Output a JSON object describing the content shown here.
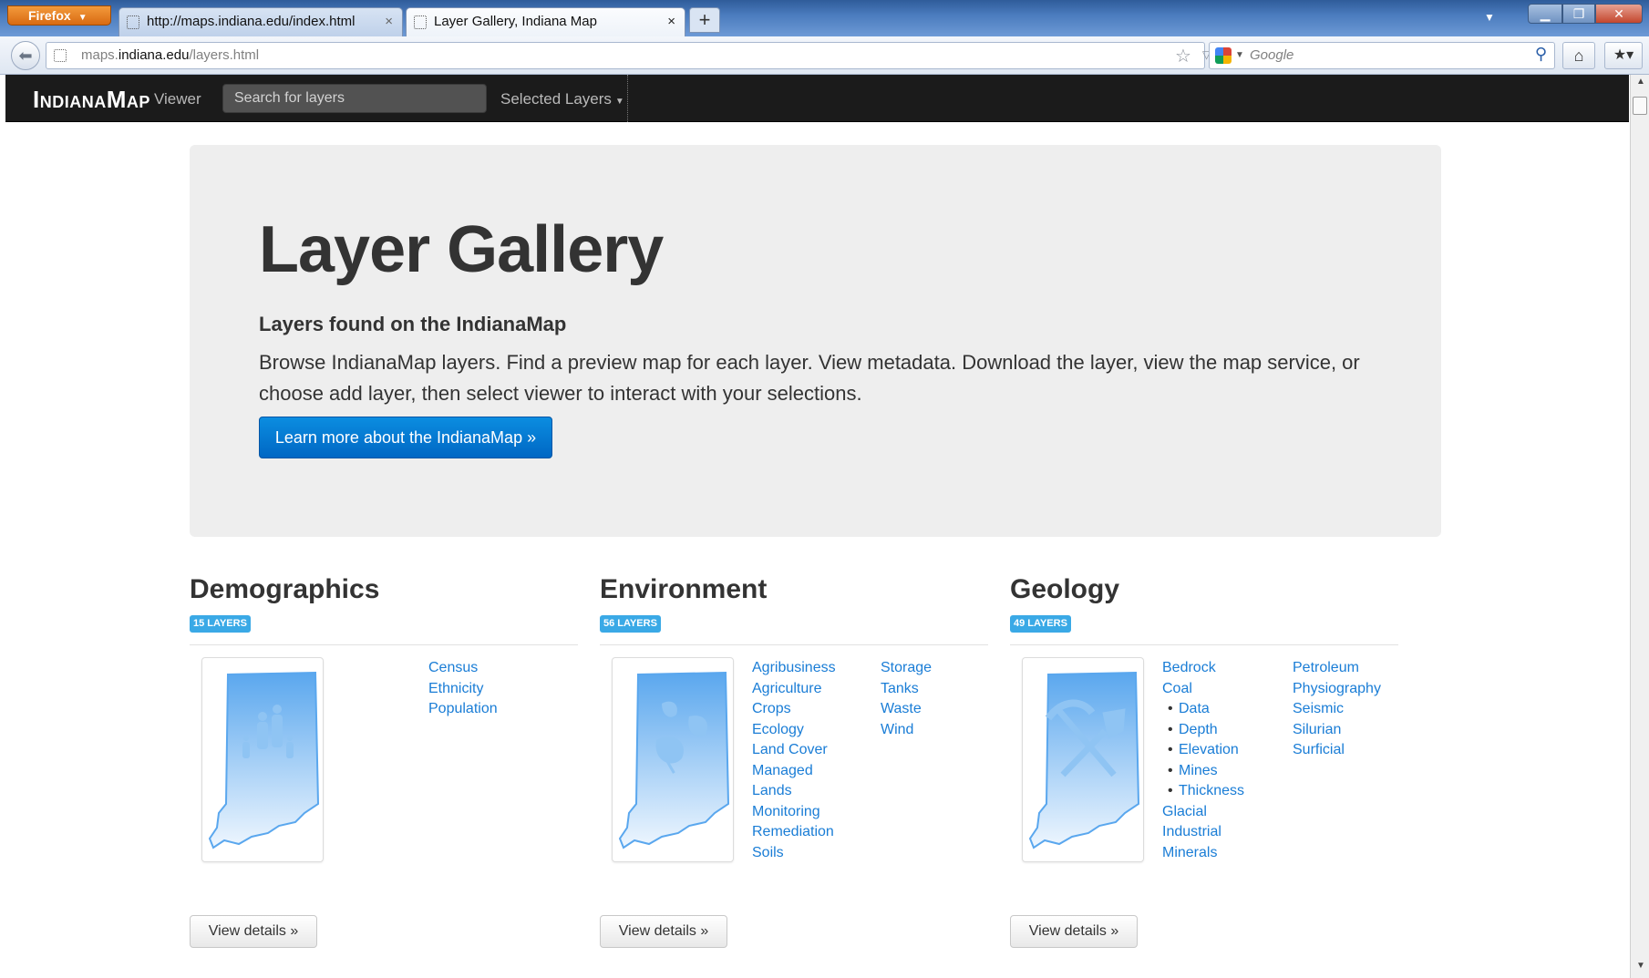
{
  "browser": {
    "menu_button": "Firefox",
    "tabs": [
      {
        "title": "http://maps.indiana.edu/index.html",
        "close": "×"
      },
      {
        "title": "Layer Gallery, Indiana Map",
        "close": "×"
      }
    ],
    "new_tab": "+",
    "url_domain_prefix": "maps.",
    "url_domain": "indiana.edu",
    "url_path": "/layers.html",
    "search_placeholder": "Google"
  },
  "site_nav": {
    "brand": "IndianaMap",
    "viewer": "Viewer",
    "search_placeholder": "Search for layers",
    "selected_layers": "Selected Layers"
  },
  "hero": {
    "title": "Layer Gallery",
    "subtitle": "Layers found on the IndianaMap",
    "description": "Browse IndianaMap layers. Find a preview map for each layer. View metadata. Download the layer, view the map service, or choose add layer, then select viewer to interact with your selections.",
    "button": "Learn more about the IndianaMap »"
  },
  "categories": [
    {
      "title": "Demographics",
      "badge": "15 LAYERS",
      "icon": "family-icon",
      "columns": [
        [
          "Census",
          "Ethnicity",
          "Population"
        ]
      ],
      "button": "View details »"
    },
    {
      "title": "Environment",
      "badge": "56 LAYERS",
      "icon": "leaf-icon",
      "columns": [
        [
          "Agribusiness",
          "Agriculture",
          "Crops",
          "Ecology",
          "Land Cover",
          "Managed",
          "Lands",
          "Monitoring",
          "Remediation",
          "Soils"
        ],
        [
          "Storage",
          "Tanks",
          "Waste",
          "Wind"
        ]
      ],
      "button": "View details »"
    },
    {
      "title": "Geology",
      "badge": "49 LAYERS",
      "icon": "pick-shovel-icon",
      "columns": [
        [
          "Bedrock",
          "Coal",
          "Data",
          "Depth",
          "Elevation",
          "Mines",
          "Thickness",
          "Glacial",
          "Industrial",
          "Minerals"
        ],
        [
          "Petroleum",
          "Physiography",
          "Seismic",
          "Silurian",
          "Surficial"
        ]
      ],
      "button": "View details »"
    }
  ],
  "colors": {
    "link": "#1a7dd6",
    "badge": "#3aa9e6",
    "primary_button": "#0074cc",
    "navbar": "#1b1b1b",
    "hero_bg": "#eeeeee"
  }
}
